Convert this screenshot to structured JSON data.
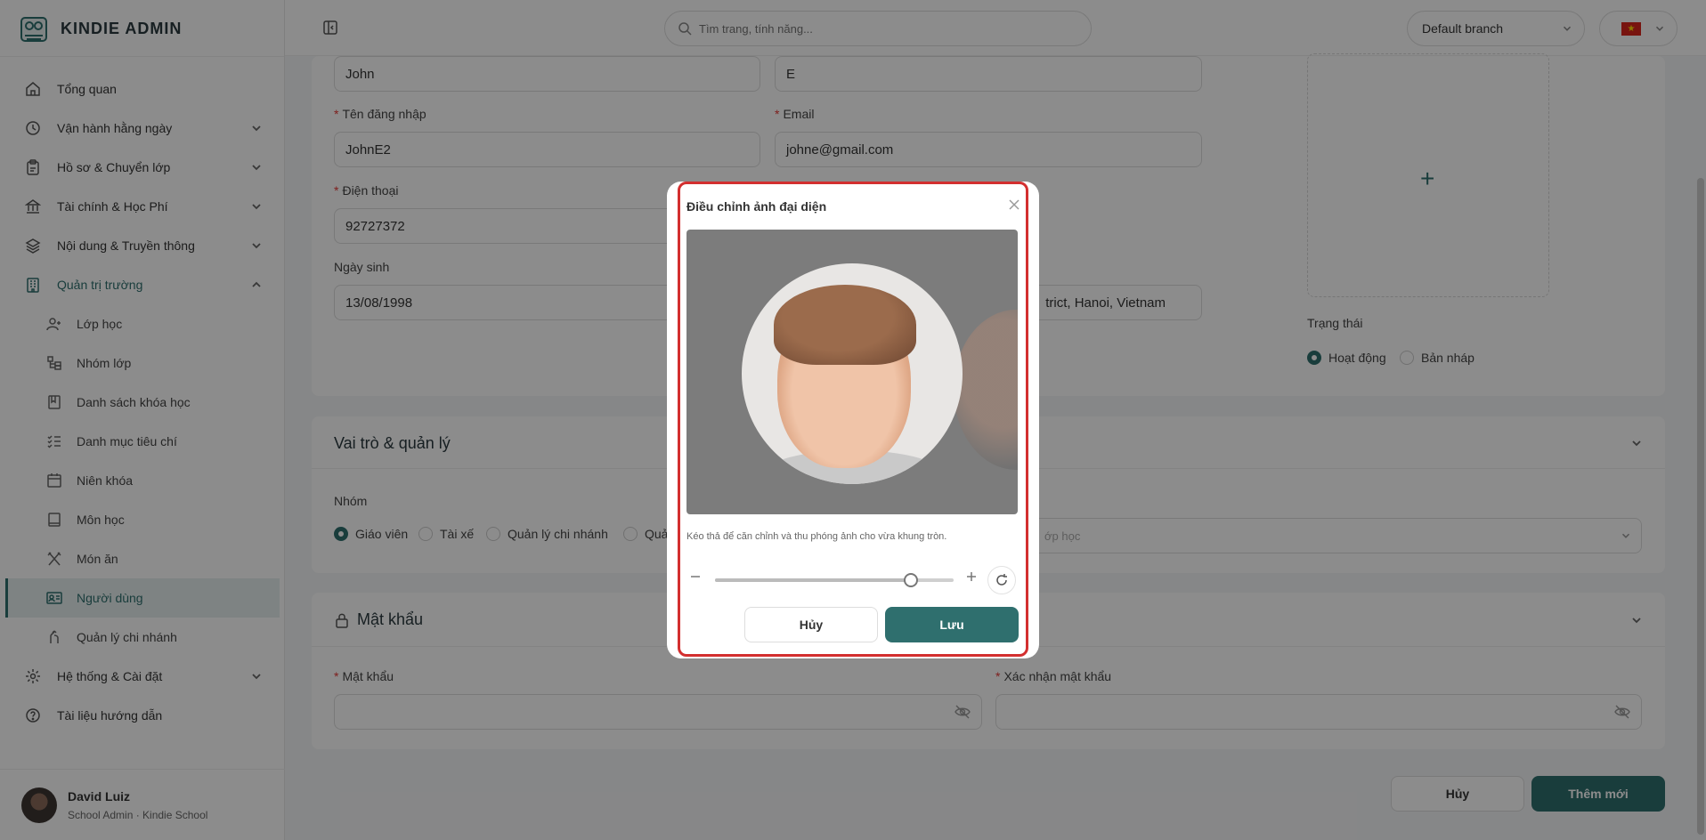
{
  "app": {
    "title": "KINDIE ADMIN"
  },
  "sidebar": {
    "items": [
      {
        "label": "Tổng quan",
        "icon": "home-icon"
      },
      {
        "label": "Vận hành hằng ngày",
        "icon": "clock-icon"
      },
      {
        "label": "Hồ sơ & Chuyển lớp",
        "icon": "clipboard-icon"
      },
      {
        "label": "Tài chính & Học Phí",
        "icon": "bank-icon"
      },
      {
        "label": "Nội dung & Truyền thông",
        "icon": "layers-icon"
      },
      {
        "label": "Quản trị trường",
        "icon": "building-icon"
      }
    ],
    "subitems": [
      {
        "label": "Lớp học",
        "icon": "user-plus-icon"
      },
      {
        "label": "Nhóm lớp",
        "icon": "group-icon"
      },
      {
        "label": "Danh sách khóa học",
        "icon": "book-icon"
      },
      {
        "label": "Danh mục tiêu chí",
        "icon": "list-check-icon"
      },
      {
        "label": "Niên khóa",
        "icon": "calendar-icon"
      },
      {
        "label": "Môn học",
        "icon": "notebook-icon"
      },
      {
        "label": "Món ăn",
        "icon": "utensils-icon"
      },
      {
        "label": "Người dùng",
        "icon": "id-card-icon"
      },
      {
        "label": "Quản lý chi nhánh",
        "icon": "branch-icon"
      }
    ],
    "bottom_items": [
      {
        "label": "Hệ thống & Cài đặt",
        "icon": "gear-icon"
      },
      {
        "label": "Tài liệu hướng dẫn",
        "icon": "help-circle-icon"
      }
    ],
    "user": {
      "name": "David Luiz",
      "role": "School Admin · Kindie School"
    }
  },
  "topbar": {
    "search_placeholder": "Tìm trang, tính năng...",
    "branch": "Default branch"
  },
  "form": {
    "first_name": "John",
    "last_name": "E",
    "username_label": "Tên đăng nhập",
    "username": "JohnE2",
    "email_label": "Email",
    "email": "johne@gmail.com",
    "phone_label": "Điện thoại",
    "phone": "92727372",
    "dob_label": "Ngày sinh",
    "dob": "13/08/1998",
    "address_partial": "trict, Hanoi, Vietnam",
    "status_label": "Trạng thái",
    "status_active": "Hoạt động",
    "status_draft": "Bản nháp",
    "roles_title": "Vai trò & quản lý",
    "group_label": "Nhóm",
    "groups": [
      "Giáo viên",
      "Tài xế",
      "Quản lý chi nhánh",
      "Quả"
    ],
    "class_placeholder": "ớp học",
    "password_title": "Mật khẩu",
    "password_label": "Mật khẩu",
    "confirm_label": "Xác nhận mật khẩu",
    "cancel": "Hủy",
    "submit": "Thêm mới"
  },
  "modal": {
    "title": "Điều chỉnh ảnh đại diện",
    "hint": "Kéo thả để căn chỉnh và thu phóng ảnh cho vừa khung tròn.",
    "zoom": 0.82,
    "cancel": "Hủy",
    "save": "Lưu"
  },
  "colors": {
    "accent": "#2f6f6e",
    "required": "#e53935",
    "highlight": "#d32f2f"
  }
}
